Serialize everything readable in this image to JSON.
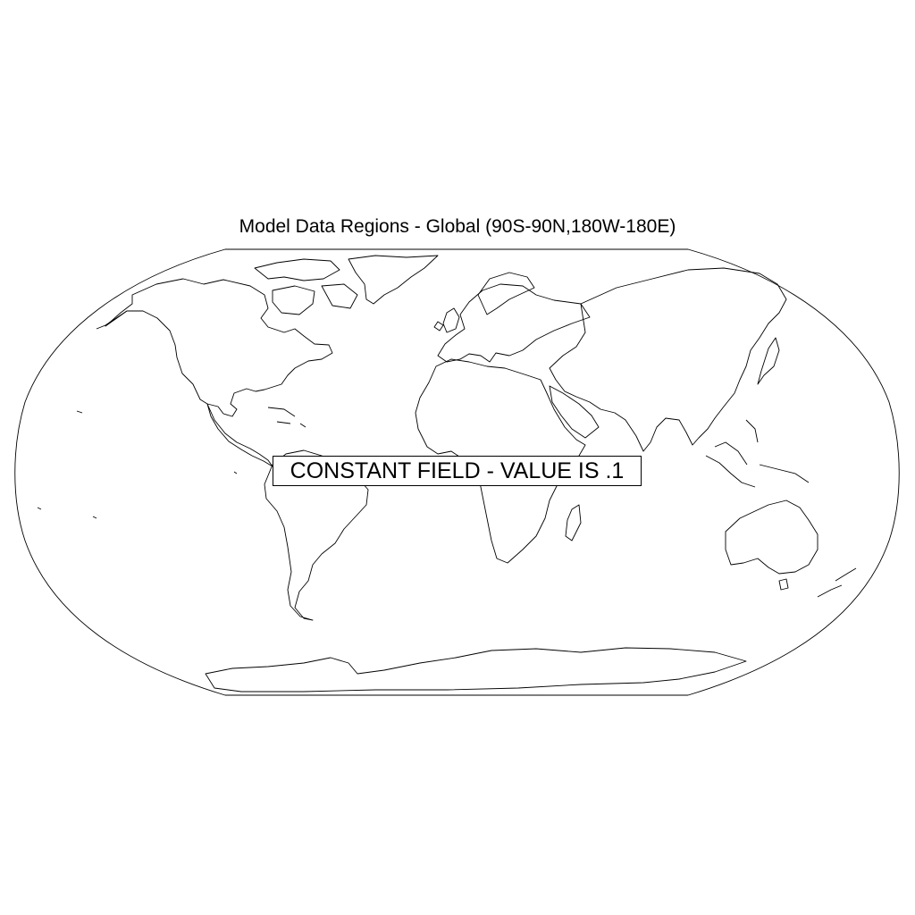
{
  "map": {
    "title": "Model Data Regions - Global (90S-90N,180W-180E)",
    "notice": "CONSTANT FIELD - VALUE IS .1",
    "projection": "Robinson",
    "extent": {
      "lat": [
        -90,
        90
      ],
      "lon": [
        -180,
        180
      ]
    },
    "line_color": "#000000",
    "background": "#ffffff"
  }
}
